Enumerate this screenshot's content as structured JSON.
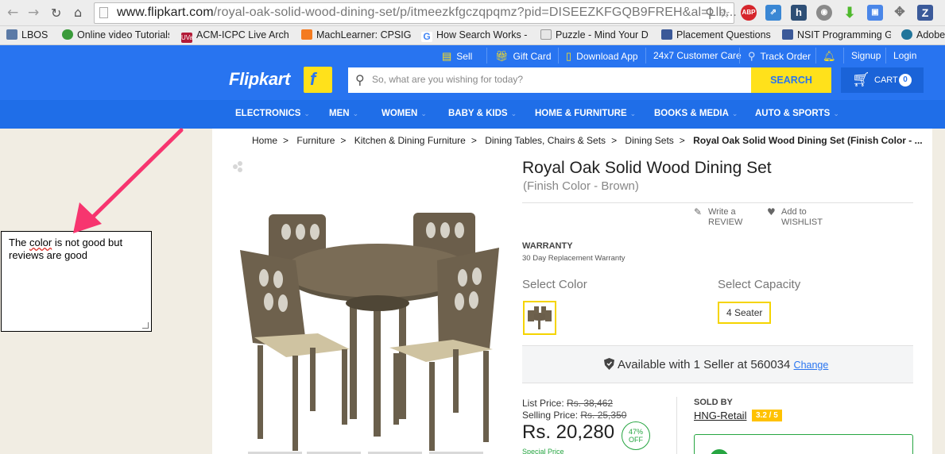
{
  "browser": {
    "url_host": "www.flipkart.com",
    "url_path": "/royal-oak-solid-wood-dining-set/p/itmeezkfgczqpqmz?pid=DISEEZKFGQB9FREH&al=Llb...",
    "extensions": [
      "ABP",
      "h",
      "Z"
    ],
    "bookmarks": [
      "LBOS",
      "Online video Tutorials",
      "ACM-ICPC Live Arch",
      "MachLearner: CPSIG",
      "How Search Works -",
      "Puzzle - Mind Your D",
      "Placement Questions",
      "NSIT Programming G",
      "Adobe"
    ],
    "bookmark_icons": {
      "uva": "UVa",
      "google": "G"
    }
  },
  "header": {
    "links": [
      "Sell",
      "Gift Card",
      "Download App",
      "24x7 Customer Care",
      "Track Order",
      "Signup",
      "Login"
    ],
    "logo": "Flipkart",
    "logo_mark": "f",
    "search_placeholder": "So, what are you wishing for today?",
    "search_button": "SEARCH",
    "cart_label": "CART",
    "cart_count": "0"
  },
  "categories": [
    "ELECTRONICS",
    "MEN",
    "WOMEN",
    "BABY & KIDS",
    "HOME & FURNITURE",
    "BOOKS & MEDIA",
    "AUTO & SPORTS"
  ],
  "note": {
    "text_before": "The ",
    "text_squiggle": "color",
    "text_after": " is not good but reviews are good"
  },
  "breadcrumb": [
    "Home",
    "Furniture",
    "Kitchen & Dining Furniture",
    "Dining Tables, Chairs & Sets",
    "Dining Sets",
    "Royal Oak Solid Wood Dining Set (Finish Color - ..."
  ],
  "breadcrumb_separator": ">",
  "product": {
    "title": "Royal Oak Solid Wood Dining Set",
    "subtitle": "(Finish Color - Brown)",
    "write_review_1": "Write a",
    "write_review_2": "REVIEW",
    "wishlist_1": "Add to",
    "wishlist_2": "WISHLIST",
    "warranty_heading": "WARRANTY",
    "warranty_text": "30 Day Replacement Warranty",
    "select_color": "Select Color",
    "select_capacity": "Select Capacity",
    "capacity_value": "4 Seater",
    "availability": "Available with 1 Seller at 560034",
    "change": "Change",
    "list_price_label": "List Price:",
    "list_price": "Rs. 38,462",
    "selling_price_label": "Selling Price:",
    "selling_price": "Rs. 25,350",
    "price": "Rs. 20,280",
    "discount_pct": "47%",
    "discount_label": "OFF",
    "special_price": "Special Price",
    "sold_by": "SOLD BY",
    "seller": "HNG-Retail",
    "seller_rating": "3.2 / 5"
  },
  "colors": {
    "brand_blue": "#2874f0",
    "brand_yellow": "#ffe11b",
    "annotation_arrow": "#f7356f",
    "green": "#26a541"
  },
  "icons": [
    "back-icon",
    "forward-icon",
    "reload-icon",
    "home-icon",
    "search-icon",
    "star-icon",
    "cart-icon",
    "bell-icon",
    "location-pin-icon",
    "heart-icon",
    "pencil-icon",
    "shield-icon"
  ]
}
